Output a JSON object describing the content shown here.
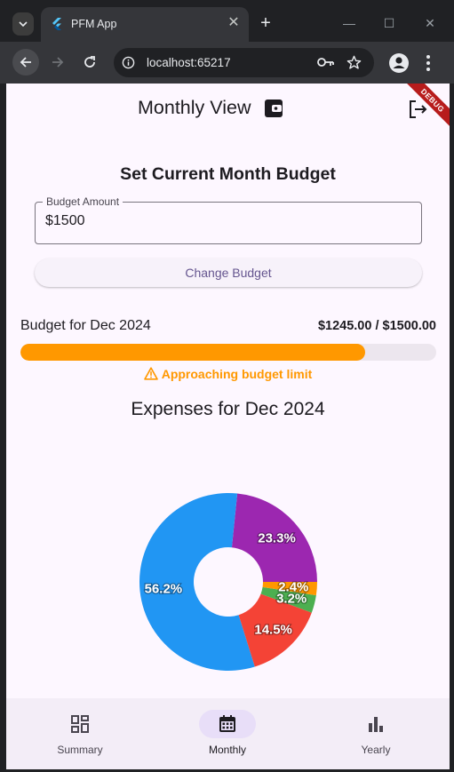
{
  "browser": {
    "tab_title": "PFM App",
    "tab_close_icon": "close-icon",
    "new_tab_icon": "plus-icon",
    "url": "localhost:65217"
  },
  "header": {
    "title": "Monthly View",
    "title_icon": "wallet-icon",
    "action_icon": "logout-icon",
    "debug_banner": "DEBUG"
  },
  "budget_form": {
    "title": "Set Current Month Budget",
    "field_label": "Budget Amount",
    "field_value": "$1500",
    "button_label": "Change Budget"
  },
  "budget_status": {
    "label": "Budget for Dec 2024",
    "amount": "$1245.00 / $1500.00",
    "progress": 0.83,
    "progress_color": "#ff9800",
    "warning_icon": "warning-icon",
    "warning": "Approaching budget limit"
  },
  "expenses": {
    "title": "Expenses for Dec 2024"
  },
  "chart_data": {
    "type": "pie",
    "donut": true,
    "slices": [
      {
        "label": "23.3%",
        "value": 23.3,
        "color": "#9c27b0"
      },
      {
        "label": "56.2%",
        "value": 56.2,
        "color": "#2196f3"
      },
      {
        "label": "14.5%",
        "value": 14.5,
        "color": "#f44336"
      },
      {
        "label": "3.2%",
        "value": 3.2,
        "color": "#4caf50"
      },
      {
        "label": "2.4%",
        "value": 2.4,
        "color": "#ff9800"
      }
    ]
  },
  "bottom_nav": {
    "items": [
      {
        "label": "Summary",
        "icon": "dashboard-icon",
        "active": false
      },
      {
        "label": "Monthly",
        "icon": "calendar-icon",
        "active": true
      },
      {
        "label": "Yearly",
        "icon": "bar-chart-icon",
        "active": false
      }
    ]
  }
}
